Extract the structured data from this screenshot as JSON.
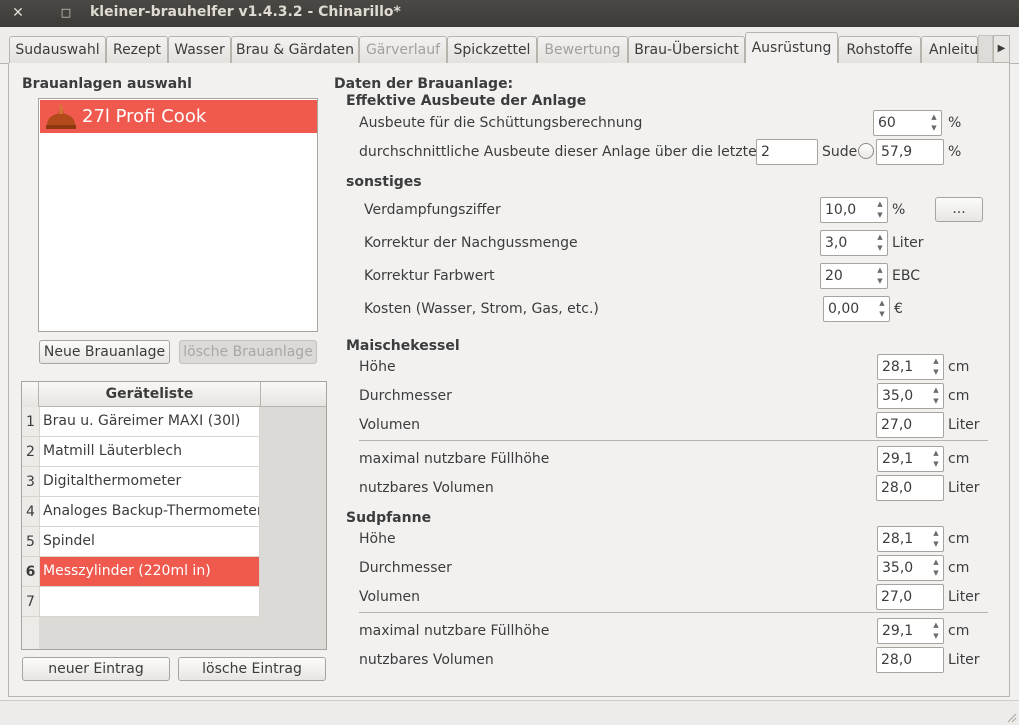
{
  "window": {
    "title": "kleiner-brauhelfer v1.4.3.2 - Chinarillo*",
    "close_glyph": "✕",
    "maximize_glyph": "□"
  },
  "tabs": [
    {
      "label": "Sudauswahl",
      "state": "normal"
    },
    {
      "label": "Rezept",
      "state": "normal"
    },
    {
      "label": "Wasser",
      "state": "normal"
    },
    {
      "label": "Brau & Gärdaten",
      "state": "normal"
    },
    {
      "label": "Gärverlauf",
      "state": "disabled"
    },
    {
      "label": "Spickzettel",
      "state": "normal"
    },
    {
      "label": "Bewertung",
      "state": "disabled"
    },
    {
      "label": "Brau-Übersicht",
      "state": "normal"
    },
    {
      "label": "Ausrüstung",
      "state": "active"
    },
    {
      "label": "Rohstoffe",
      "state": "normal"
    },
    {
      "label": "Anleitu",
      "state": "normal"
    }
  ],
  "tab_scroll_glyph": "▶",
  "left": {
    "heading": "Brauanlagen auswahl",
    "anlagen": [
      {
        "name": "27l Profi Cook",
        "icon": "kettle-icon"
      }
    ],
    "new_button": "Neue Brauanlage",
    "delete_button": "lösche Brauanlage",
    "table": {
      "header": "Geräteliste",
      "rows": [
        {
          "num": "1",
          "name": "Brau u. Gäreimer MAXI (30l)"
        },
        {
          "num": "2",
          "name": "Matmill Läuterblech"
        },
        {
          "num": "3",
          "name": "Digitalthermometer"
        },
        {
          "num": "4",
          "name": "Analoges Backup-Thermometer"
        },
        {
          "num": "5",
          "name": "Spindel"
        },
        {
          "num": "6",
          "name": "Messzylinder (220ml in)"
        },
        {
          "num": "7",
          "name": ""
        }
      ],
      "selected_row": "6"
    },
    "new_entry_button": "neuer Eintrag",
    "delete_entry_button": "lösche Eintrag"
  },
  "right": {
    "heading": "Daten der Brauanlage:",
    "effektiv": {
      "heading": "Effektive Ausbeute der Anlage",
      "ausbeute_label": "Ausbeute für die Schüttungsberechnung",
      "ausbeute_value": "60",
      "ausbeute_unit": "%",
      "durchschnitt_label": "durchschnittliche Ausbeute dieser Anlage über die letzten",
      "sude_count": "2",
      "sude_label": "Sude",
      "durchschnitt_value": "57,9",
      "durchschnitt_unit": "%"
    },
    "sonstiges": {
      "heading": "sonstiges",
      "verdampfung_label": "Verdampfungsziffer",
      "verdampfung_value": "10,0",
      "verdampfung_unit": "%",
      "more_button": "...",
      "nachguss_label": "Korrektur der Nachgussmenge",
      "nachguss_value": "3,0",
      "nachguss_unit": "Liter",
      "farbwert_label": "Korrektur Farbwert",
      "farbwert_value": "20",
      "farbwert_unit": "EBC",
      "kosten_label": "Kosten (Wasser, Strom, Gas, etc.)",
      "kosten_value": "0,00",
      "kosten_unit": "€"
    },
    "maischekessel": {
      "heading": "Maischekessel",
      "hoehe_label": "Höhe",
      "hoehe_value": "28,1",
      "hoehe_unit": "cm",
      "durchmesser_label": "Durchmesser",
      "durchmesser_value": "35,0",
      "durchmesser_unit": "cm",
      "volumen_label": "Volumen",
      "volumen_value": "27,0",
      "volumen_unit": "Liter",
      "fuellhoehe_label": "maximal nutzbare Füllhöhe",
      "fuellhoehe_value": "29,1",
      "fuellhoehe_unit": "cm",
      "nutzvolumen_label": "nutzbares Volumen",
      "nutzvolumen_value": "28,0",
      "nutzvolumen_unit": "Liter"
    },
    "sudpfanne": {
      "heading": "Sudpfanne",
      "hoehe_label": "Höhe",
      "hoehe_value": "28,1",
      "hoehe_unit": "cm",
      "durchmesser_label": "Durchmesser",
      "durchmesser_value": "35,0",
      "durchmesser_unit": "cm",
      "volumen_label": "Volumen",
      "volumen_value": "27,0",
      "volumen_unit": "Liter",
      "fuellhoehe_label": "maximal nutzbare Füllhöhe",
      "fuellhoehe_value": "29,1",
      "fuellhoehe_unit": "cm",
      "nutzvolumen_label": "nutzbares Volumen",
      "nutzvolumen_value": "28,0",
      "nutzvolumen_unit": "Liter"
    }
  },
  "colors": {
    "selection": "#f05a4e",
    "titlebar": "#3c3b37",
    "window_bg": "#f2f1f0"
  }
}
